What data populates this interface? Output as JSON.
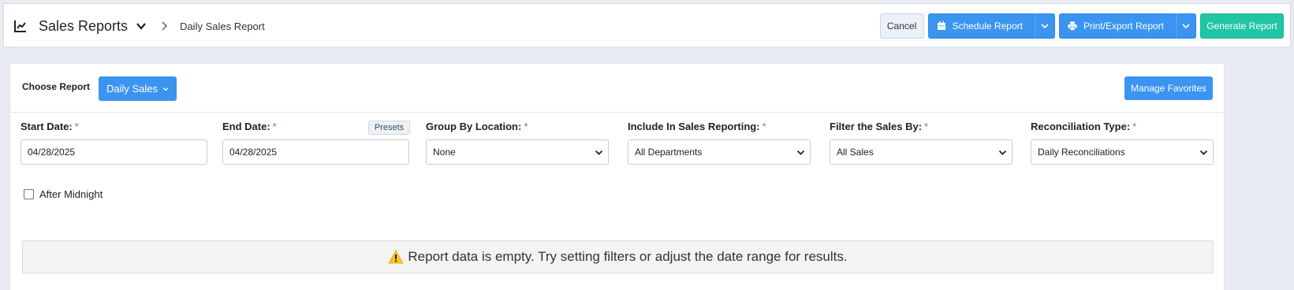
{
  "header": {
    "title": "Sales Reports",
    "breadcrumb": "Daily Sales Report",
    "icons": {
      "title_icon": "line-chart-icon",
      "dropdown": "chevron-down-icon",
      "separator": "chevron-right-icon"
    }
  },
  "toolbar": {
    "cancel_label": "Cancel",
    "schedule_label": "Schedule Report",
    "print_label": "Print/Export Report",
    "generate_label": "Generate Report",
    "colors": {
      "primary": "#3b94f0",
      "teal": "#20c5a5"
    }
  },
  "choose": {
    "label": "Choose Report",
    "selected": "Daily Sales",
    "favorites_label": "Manage Favorites"
  },
  "filters": {
    "start_date": {
      "label": "Start Date:",
      "value": "04/28/2025",
      "required": "*"
    },
    "end_date": {
      "label": "End Date:",
      "value": "04/28/2025",
      "required": "*",
      "presets_label": "Presets"
    },
    "group_by": {
      "label": "Group By Location:",
      "value": "None",
      "required": "*"
    },
    "include": {
      "label": "Include In Sales Reporting:",
      "value": "All Departments",
      "required": "*"
    },
    "filter_by": {
      "label": "Filter the Sales By:",
      "value": "All Sales",
      "required": "*"
    },
    "reconciliation": {
      "label": "Reconciliation Type:",
      "value": "Daily Reconciliations",
      "required": "*"
    }
  },
  "options": {
    "after_midnight_label": "After Midnight",
    "after_midnight_checked": false
  },
  "message": {
    "text": "Report data is empty. Try setting filters or adjust the date range for results.",
    "icon": "warning-icon",
    "color": "#f5c518"
  }
}
